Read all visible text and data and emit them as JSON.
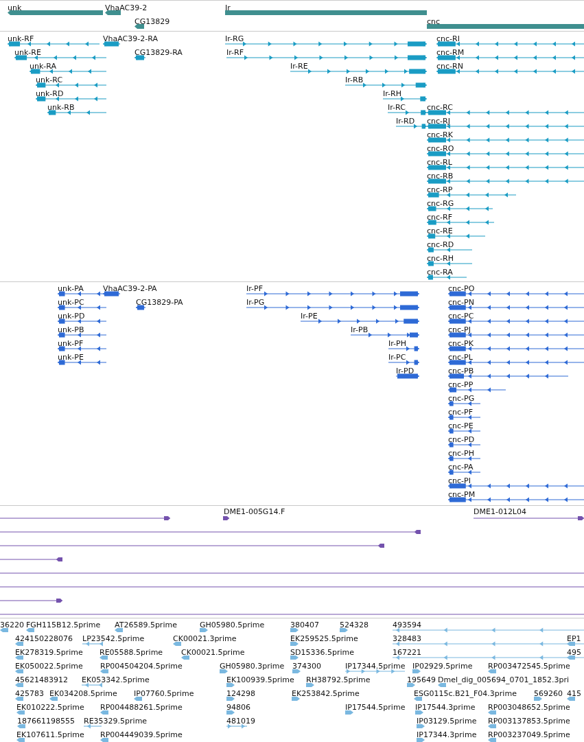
{
  "tracks": [
    {
      "kind": "gene",
      "features": [
        {
          "label": "unk",
          "reverse": true
        },
        {
          "label": "VhaAC39-2",
          "reverse": true
        },
        {
          "label": "Ir",
          "reverse": false
        },
        {
          "label": "CG13829",
          "reverse": true
        },
        {
          "label": "cnc",
          "reverse": false
        }
      ]
    },
    {
      "kind": "transcript",
      "features": [
        {
          "label": "unk-RF",
          "reverse": true
        },
        {
          "label": "VhaAC39-2-RA",
          "reverse": true
        },
        {
          "label": "Ir-RG",
          "reverse": false
        },
        {
          "label": "cnc-RI",
          "reverse": true
        },
        {
          "label": "unk-RE",
          "reverse": true
        },
        {
          "label": "CG13829-RA",
          "reverse": true
        },
        {
          "label": "Ir-RF",
          "reverse": false
        },
        {
          "label": "cnc-RM",
          "reverse": true
        },
        {
          "label": "unk-RA",
          "reverse": true
        },
        {
          "label": "Ir-RE",
          "reverse": false
        },
        {
          "label": "cnc-RN",
          "reverse": true
        },
        {
          "label": "unk-RC",
          "reverse": true
        },
        {
          "label": "Ir-RB",
          "reverse": false
        },
        {
          "label": "unk-RD",
          "reverse": true
        },
        {
          "label": "Ir-RH",
          "reverse": false
        },
        {
          "label": "unk-RB",
          "reverse": true
        },
        {
          "label": "Ir-RC",
          "reverse": false
        },
        {
          "label": "cnc-RC",
          "reverse": true
        },
        {
          "label": "Ir-RD",
          "reverse": false
        },
        {
          "label": "cnc-RJ",
          "reverse": true
        },
        {
          "label": "cnc-RK",
          "reverse": true
        },
        {
          "label": "cnc-RO",
          "reverse": true
        },
        {
          "label": "cnc-RL",
          "reverse": true
        },
        {
          "label": "cnc-RB",
          "reverse": true
        },
        {
          "label": "cnc-RP",
          "reverse": true
        },
        {
          "label": "cnc-RG",
          "reverse": true
        },
        {
          "label": "cnc-RF",
          "reverse": true
        },
        {
          "label": "cnc-RE",
          "reverse": true
        },
        {
          "label": "cnc-RD",
          "reverse": true
        },
        {
          "label": "cnc-RH",
          "reverse": true
        },
        {
          "label": "cnc-RA",
          "reverse": true
        }
      ]
    },
    {
      "kind": "protein",
      "features": [
        {
          "label": "unk-PA",
          "reverse": true
        },
        {
          "label": "VhaAC39-2-PA",
          "reverse": true
        },
        {
          "label": "Ir-PF",
          "reverse": false
        },
        {
          "label": "cnc-PO",
          "reverse": true
        },
        {
          "label": "unk-PC",
          "reverse": true
        },
        {
          "label": "CG13829-PA",
          "reverse": true
        },
        {
          "label": "Ir-PG",
          "reverse": false
        },
        {
          "label": "cnc-PN",
          "reverse": true
        },
        {
          "label": "unk-PD",
          "reverse": true
        },
        {
          "label": "Ir-PE",
          "reverse": false
        },
        {
          "label": "cnc-PC",
          "reverse": true
        },
        {
          "label": "unk-PB",
          "reverse": true
        },
        {
          "label": "Ir-PB",
          "reverse": false
        },
        {
          "label": "cnc-PJ",
          "reverse": true
        },
        {
          "label": "unk-PF",
          "reverse": true
        },
        {
          "label": "Ir-PH",
          "reverse": false
        },
        {
          "label": "cnc-PK",
          "reverse": true
        },
        {
          "label": "unk-PE",
          "reverse": true
        },
        {
          "label": "Ir-PC",
          "reverse": false
        },
        {
          "label": "cnc-PL",
          "reverse": true
        },
        {
          "label": "Ir-PD",
          "reverse": false
        },
        {
          "label": "cnc-PB",
          "reverse": true
        },
        {
          "label": "cnc-PP",
          "reverse": true
        },
        {
          "label": "cnc-PG",
          "reverse": true
        },
        {
          "label": "cnc-PF",
          "reverse": true
        },
        {
          "label": "cnc-PE",
          "reverse": true
        },
        {
          "label": "cnc-PD",
          "reverse": true
        },
        {
          "label": "cnc-PH",
          "reverse": true
        },
        {
          "label": "cnc-PA",
          "reverse": true
        },
        {
          "label": "cnc-PI",
          "reverse": true
        },
        {
          "label": "cnc-PM",
          "reverse": true
        }
      ]
    },
    {
      "kind": "alignment",
      "features": [
        {
          "reverse": false
        },
        {
          "label": "DME1-005G14.F",
          "reverse": false
        },
        {
          "label": "DME1-012L04",
          "reverse": false
        },
        {
          "reverse": true
        },
        {
          "reverse": true
        },
        {
          "reverse": true
        },
        {
          "clipped": true
        },
        {
          "clipped": true
        },
        {
          "reverse": false
        },
        {
          "clipped": true
        }
      ]
    },
    {
      "kind": "est",
      "features": [
        {
          "label": "36220",
          "reverse": true
        },
        {
          "label": "FGH115B12.5prime",
          "reverse": true
        },
        {
          "label": "AT26589.5prime",
          "reverse": true
        },
        {
          "label": "GH05980.5prime",
          "reverse": false
        },
        {
          "label": "380407",
          "reverse": false
        },
        {
          "label": "524328",
          "reverse": false
        },
        {
          "label": "493594",
          "reverse": true
        },
        {
          "label": "424150228076",
          "reverse": true
        },
        {
          "label": "LP23542.5prime",
          "reverse": true
        },
        {
          "label": "CK00021.3prime",
          "reverse": true
        },
        {
          "label": "EK259525.5prime",
          "reverse": false
        },
        {
          "label": "328483",
          "reverse": true
        },
        {
          "label": "EP1",
          "reverse": true
        },
        {
          "label": "EK278319.5prime",
          "reverse": true
        },
        {
          "label": "RE05588.5prime",
          "reverse": true
        },
        {
          "label": "CK00021.5prime",
          "reverse": true
        },
        {
          "label": "SD15336.5prime",
          "reverse": false
        },
        {
          "label": "167221",
          "reverse": true
        },
        {
          "label": "495",
          "reverse": true
        },
        {
          "label": "EK050022.5prime",
          "reverse": true
        },
        {
          "label": "RP004504204.5prime",
          "reverse": true
        },
        {
          "label": "GH05980.3prime",
          "reverse": false
        },
        {
          "label": "374300",
          "reverse": false
        },
        {
          "label": "IP17344.5prime",
          "reverse": false
        },
        {
          "label": "IP02929.5prime",
          "reverse": false
        },
        {
          "label": "RP003472545.5prime",
          "reverse": true
        },
        {
          "label": "45621483912",
          "reverse": true
        },
        {
          "label": "EK053342.5prime",
          "reverse": true
        },
        {
          "label": "EK100939.5prime",
          "reverse": false
        },
        {
          "label": "RH38792.5prime",
          "reverse": false
        },
        {
          "label": "195649",
          "reverse": false
        },
        {
          "label": "Dmel_dig_005694_0701_1852.3pri",
          "reverse": true
        },
        {
          "label": "425783",
          "reverse": true
        },
        {
          "label": "EK034208.5prime",
          "reverse": true
        },
        {
          "label": "IP07760.5prime",
          "reverse": true
        },
        {
          "label": "124298",
          "reverse": false
        },
        {
          "label": "EK253842.5prime",
          "reverse": false
        },
        {
          "label": "ESG0115c.B21_F04.3prime",
          "reverse": true
        },
        {
          "label": "569260",
          "reverse": false
        },
        {
          "label": "415",
          "reverse": true
        },
        {
          "label": "EK010222.5prime",
          "reverse": true
        },
        {
          "label": "RP004488261.5prime",
          "reverse": true
        },
        {
          "label": "94806",
          "reverse": false
        },
        {
          "label": "IP17544.5prime",
          "reverse": false
        },
        {
          "label": "IP17544.3prime",
          "reverse": false
        },
        {
          "label": "RP003048652.5prime",
          "reverse": true
        },
        {
          "label": "187661198555",
          "reverse": true
        },
        {
          "label": "RE35329.5prime",
          "reverse": true
        },
        {
          "label": "481019",
          "reverse": false
        },
        {
          "label": "IP03129.5prime",
          "reverse": false
        },
        {
          "label": "RP003137853.5prime",
          "reverse": true
        },
        {
          "label": "EK107611.5prime",
          "reverse": true
        },
        {
          "label": "RP004449039.5prime",
          "reverse": true
        },
        {
          "label": "IP17344.3prime",
          "reverse": false
        },
        {
          "label": "RP003237049.5prime",
          "reverse": true
        }
      ]
    }
  ]
}
